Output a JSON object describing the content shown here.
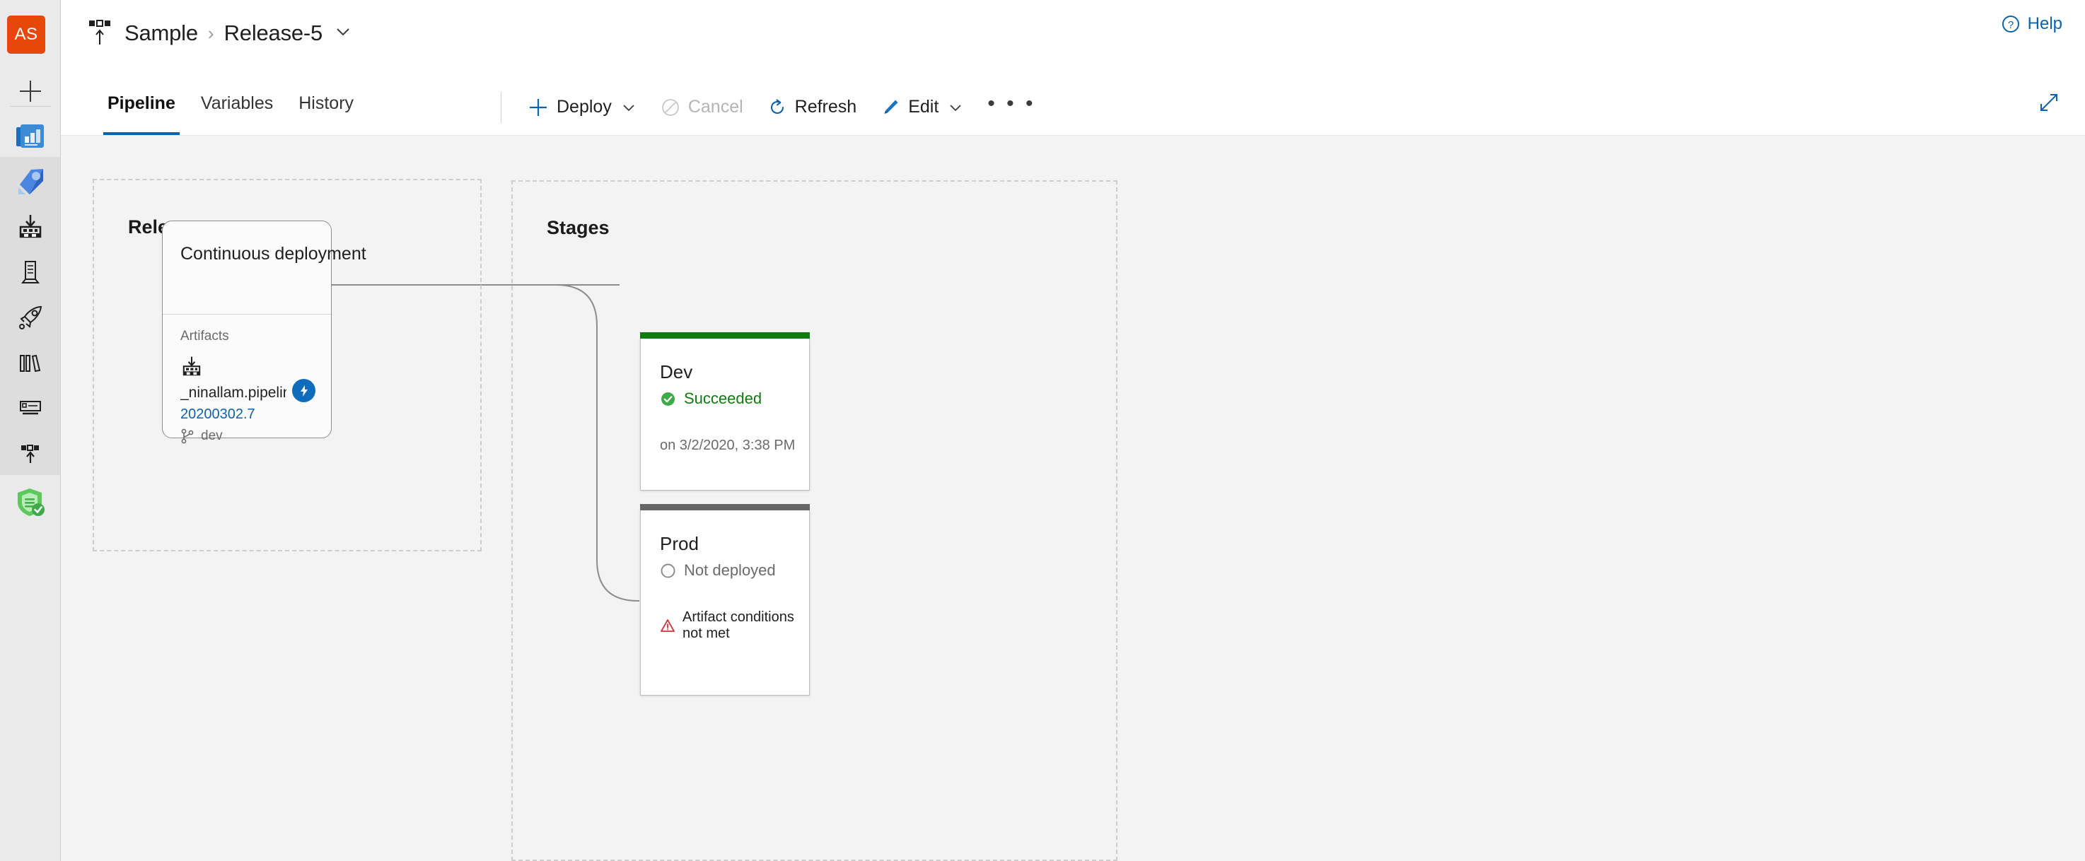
{
  "sidebar": {
    "org_avatar": "AS",
    "items": [
      {
        "name": "new-item",
        "icon": "plus-icon",
        "label": ""
      },
      {
        "name": "overview",
        "icon": "dashboard-icon",
        "label": ""
      },
      {
        "name": "pipelines",
        "icon": "azure-pipelines-rocket-icon",
        "label": ""
      },
      {
        "name": "artifacts-builds",
        "icon": "build-download-icon",
        "label": ""
      },
      {
        "name": "environments",
        "icon": "server-icon",
        "label": ""
      },
      {
        "name": "releases",
        "icon": "rocket-outline-icon",
        "label": ""
      },
      {
        "name": "library",
        "icon": "library-books-icon",
        "label": ""
      },
      {
        "name": "task-groups",
        "icon": "task-group-icon",
        "label": ""
      },
      {
        "name": "deployment-groups",
        "icon": "release-upload-icon",
        "label": ""
      },
      {
        "name": "security",
        "icon": "green-shield-check-icon",
        "label": ""
      }
    ]
  },
  "header": {
    "icon": "release-pipeline-icon",
    "project": "Sample",
    "separator": "›",
    "release_name": "Release-5",
    "release_chevron": "⌄",
    "help_label": "Help",
    "help_icon": "question-circle-icon",
    "expand_icon": "expand-diagonal-icon"
  },
  "toolbar": {
    "tabs": [
      {
        "label": "Pipeline",
        "active": true
      },
      {
        "label": "Variables",
        "active": false
      },
      {
        "label": "History",
        "active": false
      }
    ],
    "actions": [
      {
        "label": "Deploy",
        "icon": "plus-icon",
        "has_chevron": true,
        "disabled": false
      },
      {
        "label": "Cancel",
        "icon": "block-icon",
        "has_chevron": false,
        "disabled": true
      },
      {
        "label": "Refresh",
        "icon": "refresh-icon",
        "has_chevron": false,
        "disabled": false
      },
      {
        "label": "Edit",
        "icon": "pencil-icon",
        "has_chevron": true,
        "disabled": false
      }
    ],
    "more_label": "• • •"
  },
  "canvas": {
    "release_panel": {
      "title": "Release",
      "card": {
        "title": "Continuous deployment",
        "artifacts_label": "Artifacts",
        "artifact_icon": "build-artifact-icon",
        "artifact_name": "_ninallam.pipeline...",
        "artifact_version": "20200302.7",
        "branch_icon": "branch-icon",
        "branch_name": "dev",
        "trigger_icon": "lightning-bolt-icon"
      }
    },
    "stages_panel": {
      "title": "Stages",
      "stages": [
        {
          "name": "Dev",
          "status": "Succeeded",
          "status_icon": "check-circle-icon",
          "bar_color": "#107c10",
          "status_color": "#107c10",
          "subtext": "on 3/2/2020, 3:38 PM",
          "warning": null
        },
        {
          "name": "Prod",
          "status": "Not deployed",
          "status_icon": "empty-circle-icon",
          "bar_color": "#666666",
          "status_color": "#6b6b6b",
          "subtext": null,
          "warning": "Artifact conditions not met"
        }
      ]
    }
  },
  "colors": {
    "accent": "#0f62a8",
    "success": "#107c10",
    "warning": "#d13438",
    "neutral": "#666666",
    "org_avatar_bg": "#e8470a",
    "canvas_bg": "#f3f3f3"
  }
}
